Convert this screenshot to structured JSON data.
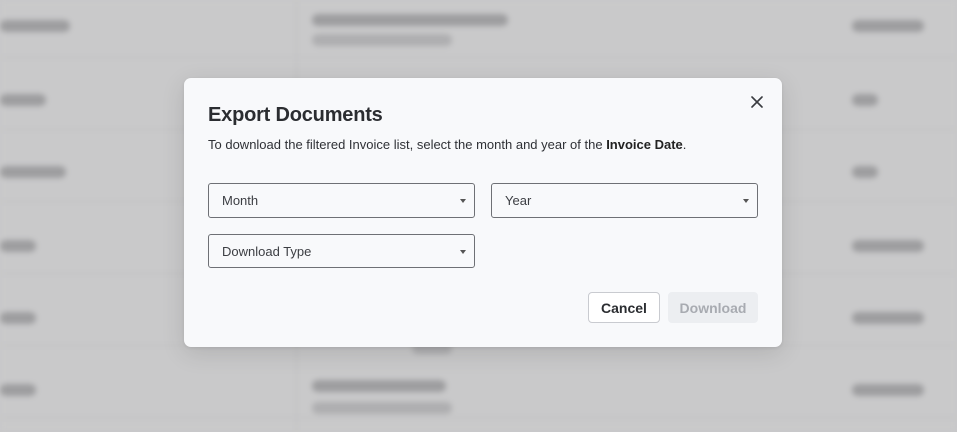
{
  "dialog": {
    "title": "Export Documents",
    "description_prefix": "To download the filtered Invoice list, select the month and year of the ",
    "description_bold": "Invoice Date",
    "description_suffix": ".",
    "close_icon": "close-icon"
  },
  "fields": {
    "month": {
      "label": "Month",
      "icon": "caret-down-icon"
    },
    "year": {
      "label": "Year",
      "icon": "caret-down-icon"
    },
    "download_type": {
      "label": "Download Type",
      "icon": "caret-down-icon"
    }
  },
  "actions": {
    "cancel_label": "Cancel",
    "download_label": "Download",
    "download_disabled": true
  },
  "colors": {
    "overlay": "#c9c9ca",
    "modal_bg": "#f8f9fb",
    "border": "#6e7075",
    "text": "#2b2d31",
    "disabled_text": "#a8abb1"
  }
}
